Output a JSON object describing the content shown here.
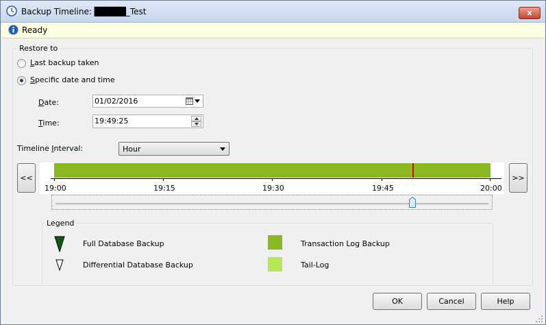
{
  "window": {
    "title": "Backup Timeline: █████_Test",
    "close_label": "x"
  },
  "status": {
    "text": "Ready"
  },
  "restore": {
    "group_label": "Restore to",
    "option_last": {
      "prefix": "L",
      "rest": "ast backup taken",
      "checked": false
    },
    "option_specific": {
      "prefix": "S",
      "rest": "pecific date and time",
      "checked": true
    },
    "date_label_prefix": "D",
    "date_label_rest": "ate:",
    "date_value": "01/02/2016",
    "time_label_prefix": "T",
    "time_label_rest": "ime:",
    "time_value": "19:49:25"
  },
  "timeline": {
    "interval_label_pre": "Timeline ",
    "interval_label_u": "I",
    "interval_label_post": "nterval:",
    "interval_value": "Hour",
    "prev_label": "<<",
    "next_label": ">>",
    "ticks": [
      "19:00",
      "19:15",
      "19:30",
      "19:45",
      "20:00"
    ]
  },
  "legend": {
    "title": "Legend",
    "full_backup": "Full Database Backup",
    "differential_backup": "Differential Database Backup",
    "transaction_log": "Transaction Log Backup",
    "tail_log": "Tail-Log",
    "colors": {
      "full": "#0f5a0f",
      "transaction": "#8ab81e",
      "tail": "#b5e655",
      "marker": "#e00000"
    }
  },
  "buttons": {
    "ok": "OK",
    "cancel": "Cancel",
    "help": "Help"
  }
}
